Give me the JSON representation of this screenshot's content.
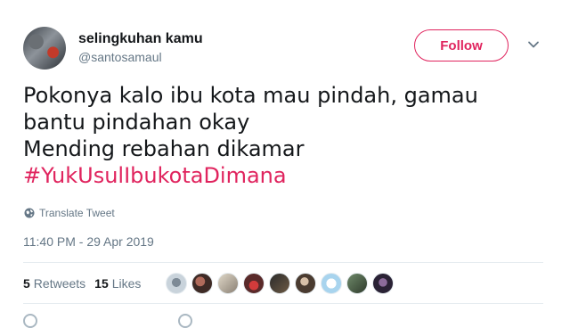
{
  "author": {
    "display_name": "selingkuhan kamu",
    "handle": "@santosamaul"
  },
  "follow_button": {
    "label": "Follow"
  },
  "menu_icon": "chevron-down-icon",
  "tweet": {
    "lines": [
      "Pokonya kalo ibu kota mau pindah, gamau",
      "bantu pindahan okay",
      "Mending rebahan dikamar"
    ],
    "hashtag": "#YukUsulIbukotaDimana"
  },
  "translate": {
    "label": "Translate Tweet",
    "icon": "globe-icon"
  },
  "timestamp": "11:40 PM - 29 Apr 2019",
  "stats": {
    "retweets_count": "5",
    "retweets_label": "Retweets",
    "likes_count": "15",
    "likes_label": "Likes"
  },
  "colors": {
    "accent": "#e0245e",
    "text": "#14171a",
    "secondary": "#657786",
    "divider": "#e6ecf0"
  }
}
